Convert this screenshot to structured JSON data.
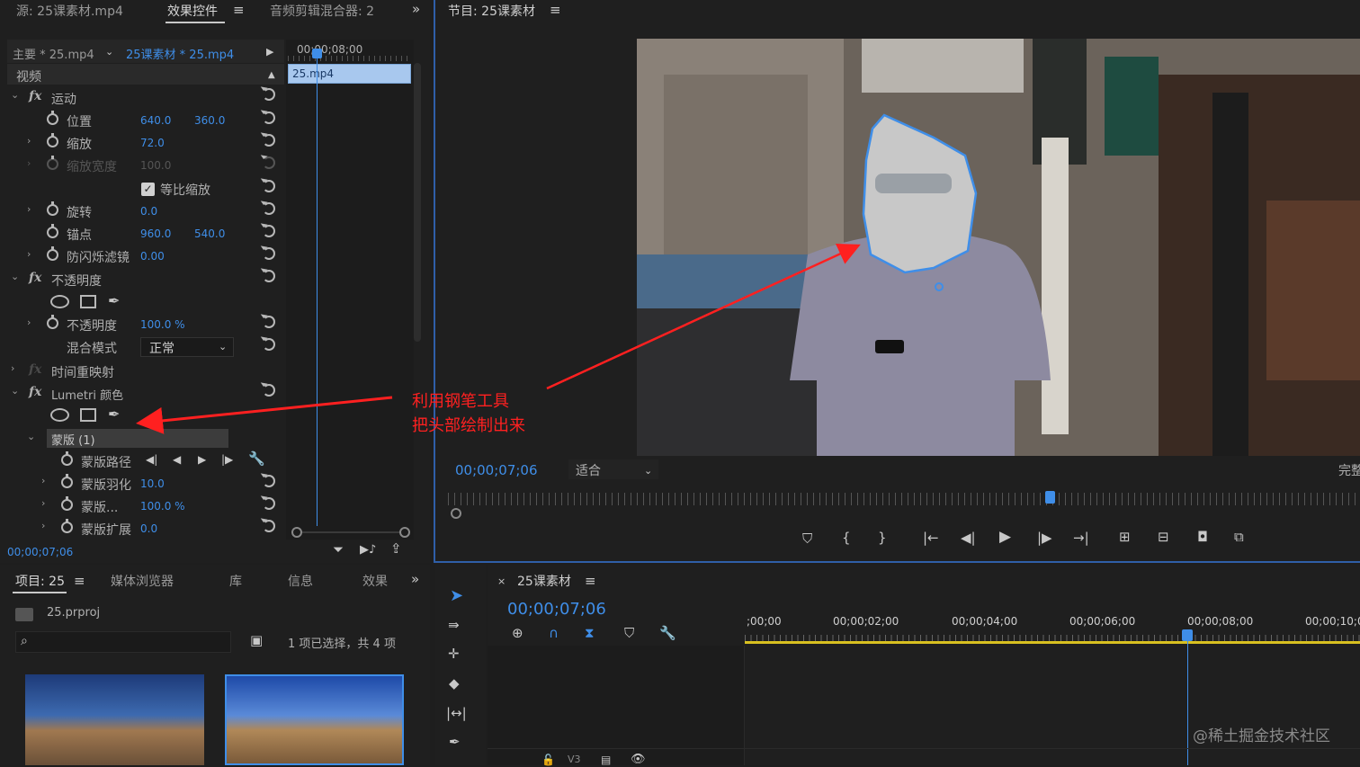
{
  "source_panel": {
    "tab_source": "源: 25课素材.mp4",
    "tab_effect_controls": "效果控件",
    "tab_audio_mixer": "音频剪辑混合器: 2",
    "master_clip": "主要 * 25.mp4",
    "sequence_clip": "25课素材 * 25.mp4",
    "mini_timecode": "00;00;08;00",
    "clip_bar_label": "25.mp4",
    "section_video": "视频",
    "fx_motion": "运动",
    "position_label": "位置",
    "position_x": "640.0",
    "position_y": "360.0",
    "scale_label": "缩放",
    "scale_value": "72.0",
    "scale_width_label": "缩放宽度",
    "scale_width_value": "100.0",
    "uniform_scale_label": "等比缩放",
    "rotation_label": "旋转",
    "rotation_value": "0.0",
    "anchor_label": "锚点",
    "anchor_x": "960.0",
    "anchor_y": "540.0",
    "antiflicker_label": "防闪烁滤镜",
    "antiflicker_value": "0.00",
    "fx_opacity": "不透明度",
    "opacity_label": "不透明度",
    "opacity_value": "100.0 %",
    "blend_label": "混合模式",
    "blend_value": "正常",
    "fx_time_remap": "时间重映射",
    "fx_lumetri": "Lumetri 颜色",
    "mask_name": "蒙版 (1)",
    "mask_path_label": "蒙版路径",
    "mask_feather_label": "蒙版羽化",
    "mask_feather_value": "10.0",
    "mask_opacity_label": "蒙版...",
    "mask_opacity_value": "100.0 %",
    "mask_expansion_label": "蒙版扩展",
    "mask_expansion_value": "0.0",
    "bottom_timecode": "00;00;07;06"
  },
  "annotation": {
    "line1": "利用钢笔工具",
    "line2": "把头部绘制出来",
    "color": "#ff2020"
  },
  "program_monitor": {
    "title": "节目: 25课素材",
    "timecode": "00;00;07;06",
    "fit_value": "适合",
    "quality_partial": "完整",
    "playhead_fraction": 0.66
  },
  "project_panel": {
    "tab_project": "项目: 25",
    "tab_media_browser": "媒体浏览器",
    "tab_library": "库",
    "tab_info": "信息",
    "tab_effects": "效果",
    "file_name": "25.prproj",
    "selection_status": "1 项已选择，共 4 项",
    "search_placeholder": ""
  },
  "timeline": {
    "title": "25课素材",
    "timecode": "00;00;07;06",
    "ruler_labels": [
      ";00;00",
      "00;00;02;00",
      "00;00;04;00",
      "00;00;06;00",
      "00;00;08;00",
      "00;00;10;0"
    ],
    "track_label": "V3",
    "playhead_fraction": 0.72
  },
  "watermark": "@稀土掘金技术社区",
  "colors": {
    "accent_blue": "#3f8ee8",
    "panel_bg": "#232323",
    "work_area_yellow": "#d8c020"
  }
}
